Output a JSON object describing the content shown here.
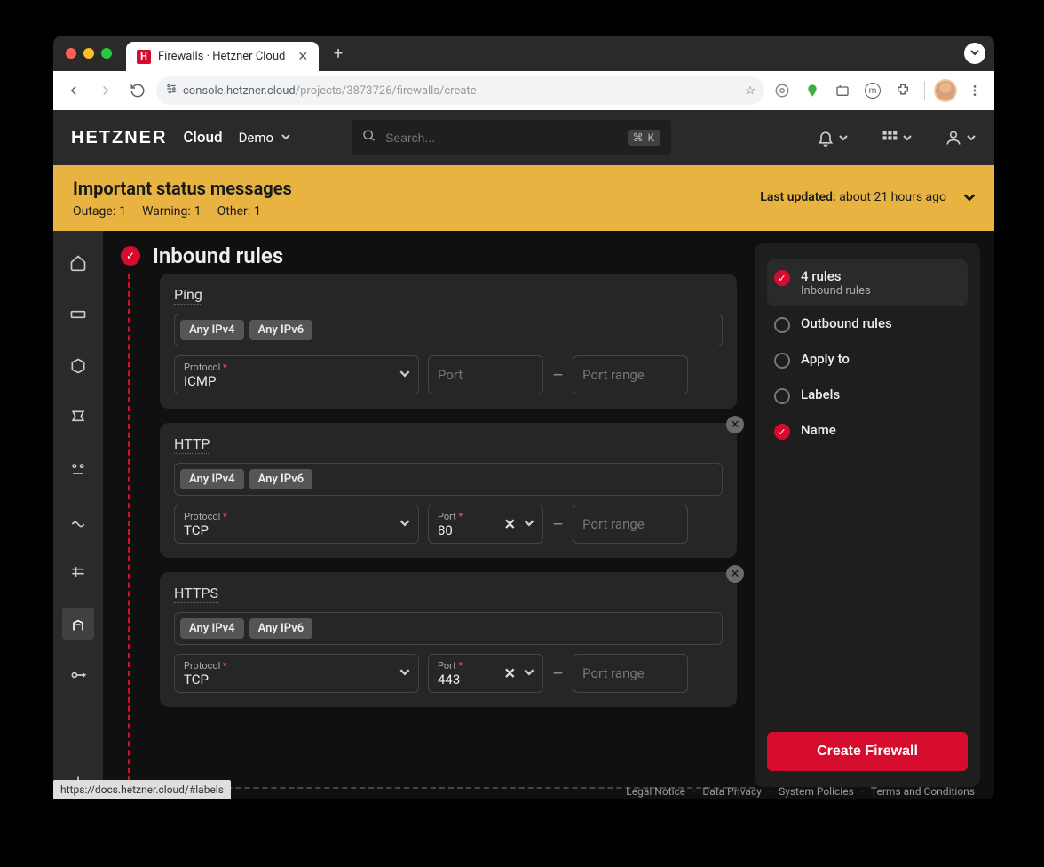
{
  "browser": {
    "tab_title": "Firewalls · Hetzner Cloud",
    "url_host": "console.hetzner.cloud",
    "url_path": "/projects/3873726/firewalls/create",
    "url_star_title": "Bookmark",
    "status_link": "https://docs.hetzner.cloud/#labels"
  },
  "header": {
    "logo": "HETZNER",
    "logo_sub": "Cloud",
    "project": "Demo",
    "search_placeholder": "Search...",
    "search_kbd": "⌘ K"
  },
  "banner": {
    "title": "Important status messages",
    "labels": {
      "outage": "Outage:",
      "warning": "Warning:",
      "other": "Other:",
      "updated": "Last updated:"
    },
    "counts": {
      "outage": "1",
      "warning": "1",
      "other": "1"
    },
    "updated_value": "about 21 hours ago"
  },
  "page": {
    "title": "Inbound rules",
    "chips": {
      "any_ipv4": "Any IPv4",
      "any_ipv6": "Any IPv6"
    },
    "field_labels": {
      "protocol": "Protocol",
      "port": "Port",
      "port_placeholder": "Port",
      "range_placeholder": "Port range",
      "req": "*"
    },
    "rules": [
      {
        "name": "Ping",
        "protocol": "ICMP",
        "port": "",
        "removable": false,
        "port_disabled": true
      },
      {
        "name": "HTTP",
        "protocol": "TCP",
        "port": "80",
        "removable": true,
        "port_disabled": false
      },
      {
        "name": "HTTPS",
        "protocol": "TCP",
        "port": "443",
        "removable": true,
        "port_disabled": false
      }
    ]
  },
  "steps": {
    "items": [
      {
        "title": "4 rules",
        "sub": "Inbound rules",
        "done": true,
        "active": true
      },
      {
        "title": "Outbound rules",
        "sub": "",
        "done": false,
        "active": false
      },
      {
        "title": "Apply to",
        "sub": "",
        "done": false,
        "active": false
      },
      {
        "title": "Labels",
        "sub": "",
        "done": false,
        "active": false
      },
      {
        "title": "Name",
        "sub": "",
        "done": true,
        "active": false
      }
    ],
    "create_label": "Create Firewall"
  },
  "footer": {
    "links": [
      "Legal Notice",
      "Data Privacy",
      "System Policies",
      "Terms and Conditions"
    ]
  }
}
